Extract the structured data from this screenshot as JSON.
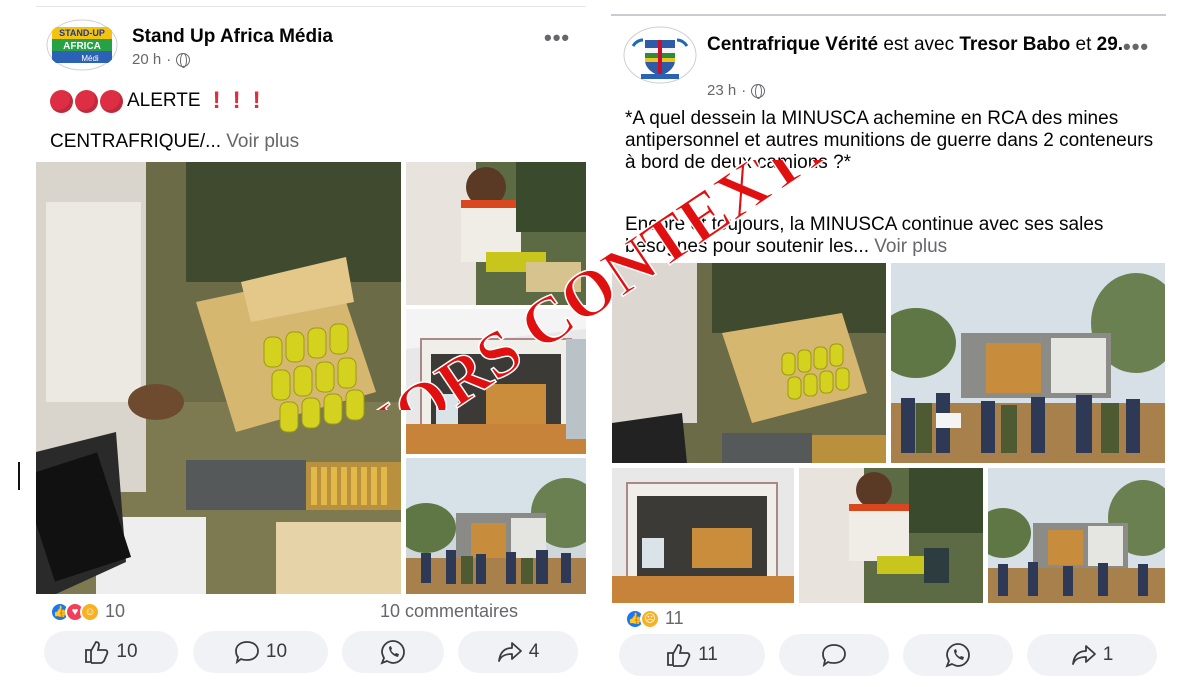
{
  "left_post": {
    "author": "Stand Up Africa Média",
    "time": "20 h",
    "avatar_text_top": "STAND-UP",
    "avatar_text_mid": "AFRICA",
    "avatar_text_bot": "Médi",
    "alert_word": "ALERTE",
    "excl": "!",
    "text_line": "CENTRAFRIQUE/...",
    "voir_plus": "Voir plus",
    "reaction_count": "10",
    "comments": "10 commentaires",
    "like_count": "10",
    "comment_count": "10",
    "share_count": "4"
  },
  "right_post": {
    "author": "Centrafrique Vérité",
    "with_word": "est avec",
    "tagged": "Tresor Babo",
    "and_word": "et",
    "others": "29.",
    "time": "23 h",
    "text_p1": "*A quel dessein la MINUSCA achemine en RCA des mines antipersonnel et autres munitions de guerre dans 2 conteneurs à bord de deux camions ?*",
    "text_p2": "Encore et toujours, la MINUSCA continue avec ses sales besognes pour soutenir les...",
    "voir_plus": "Voir plus",
    "reaction_count": "11",
    "like_count": "11",
    "share_count": "1"
  },
  "stamp": {
    "text": "HORS CONTEXTE",
    "color": "#e01010"
  },
  "icons": {
    "more": "more-options-icon",
    "globe": "globe-icon",
    "like": "thumbs-up-icon",
    "comment": "comment-icon",
    "whatsapp": "whatsapp-icon",
    "share": "share-icon"
  },
  "colors": {
    "fb_blue": "#1877f2",
    "red_alert": "#dd2e44",
    "meta_grey": "#65676b",
    "button_bg": "#f0f2f5"
  }
}
